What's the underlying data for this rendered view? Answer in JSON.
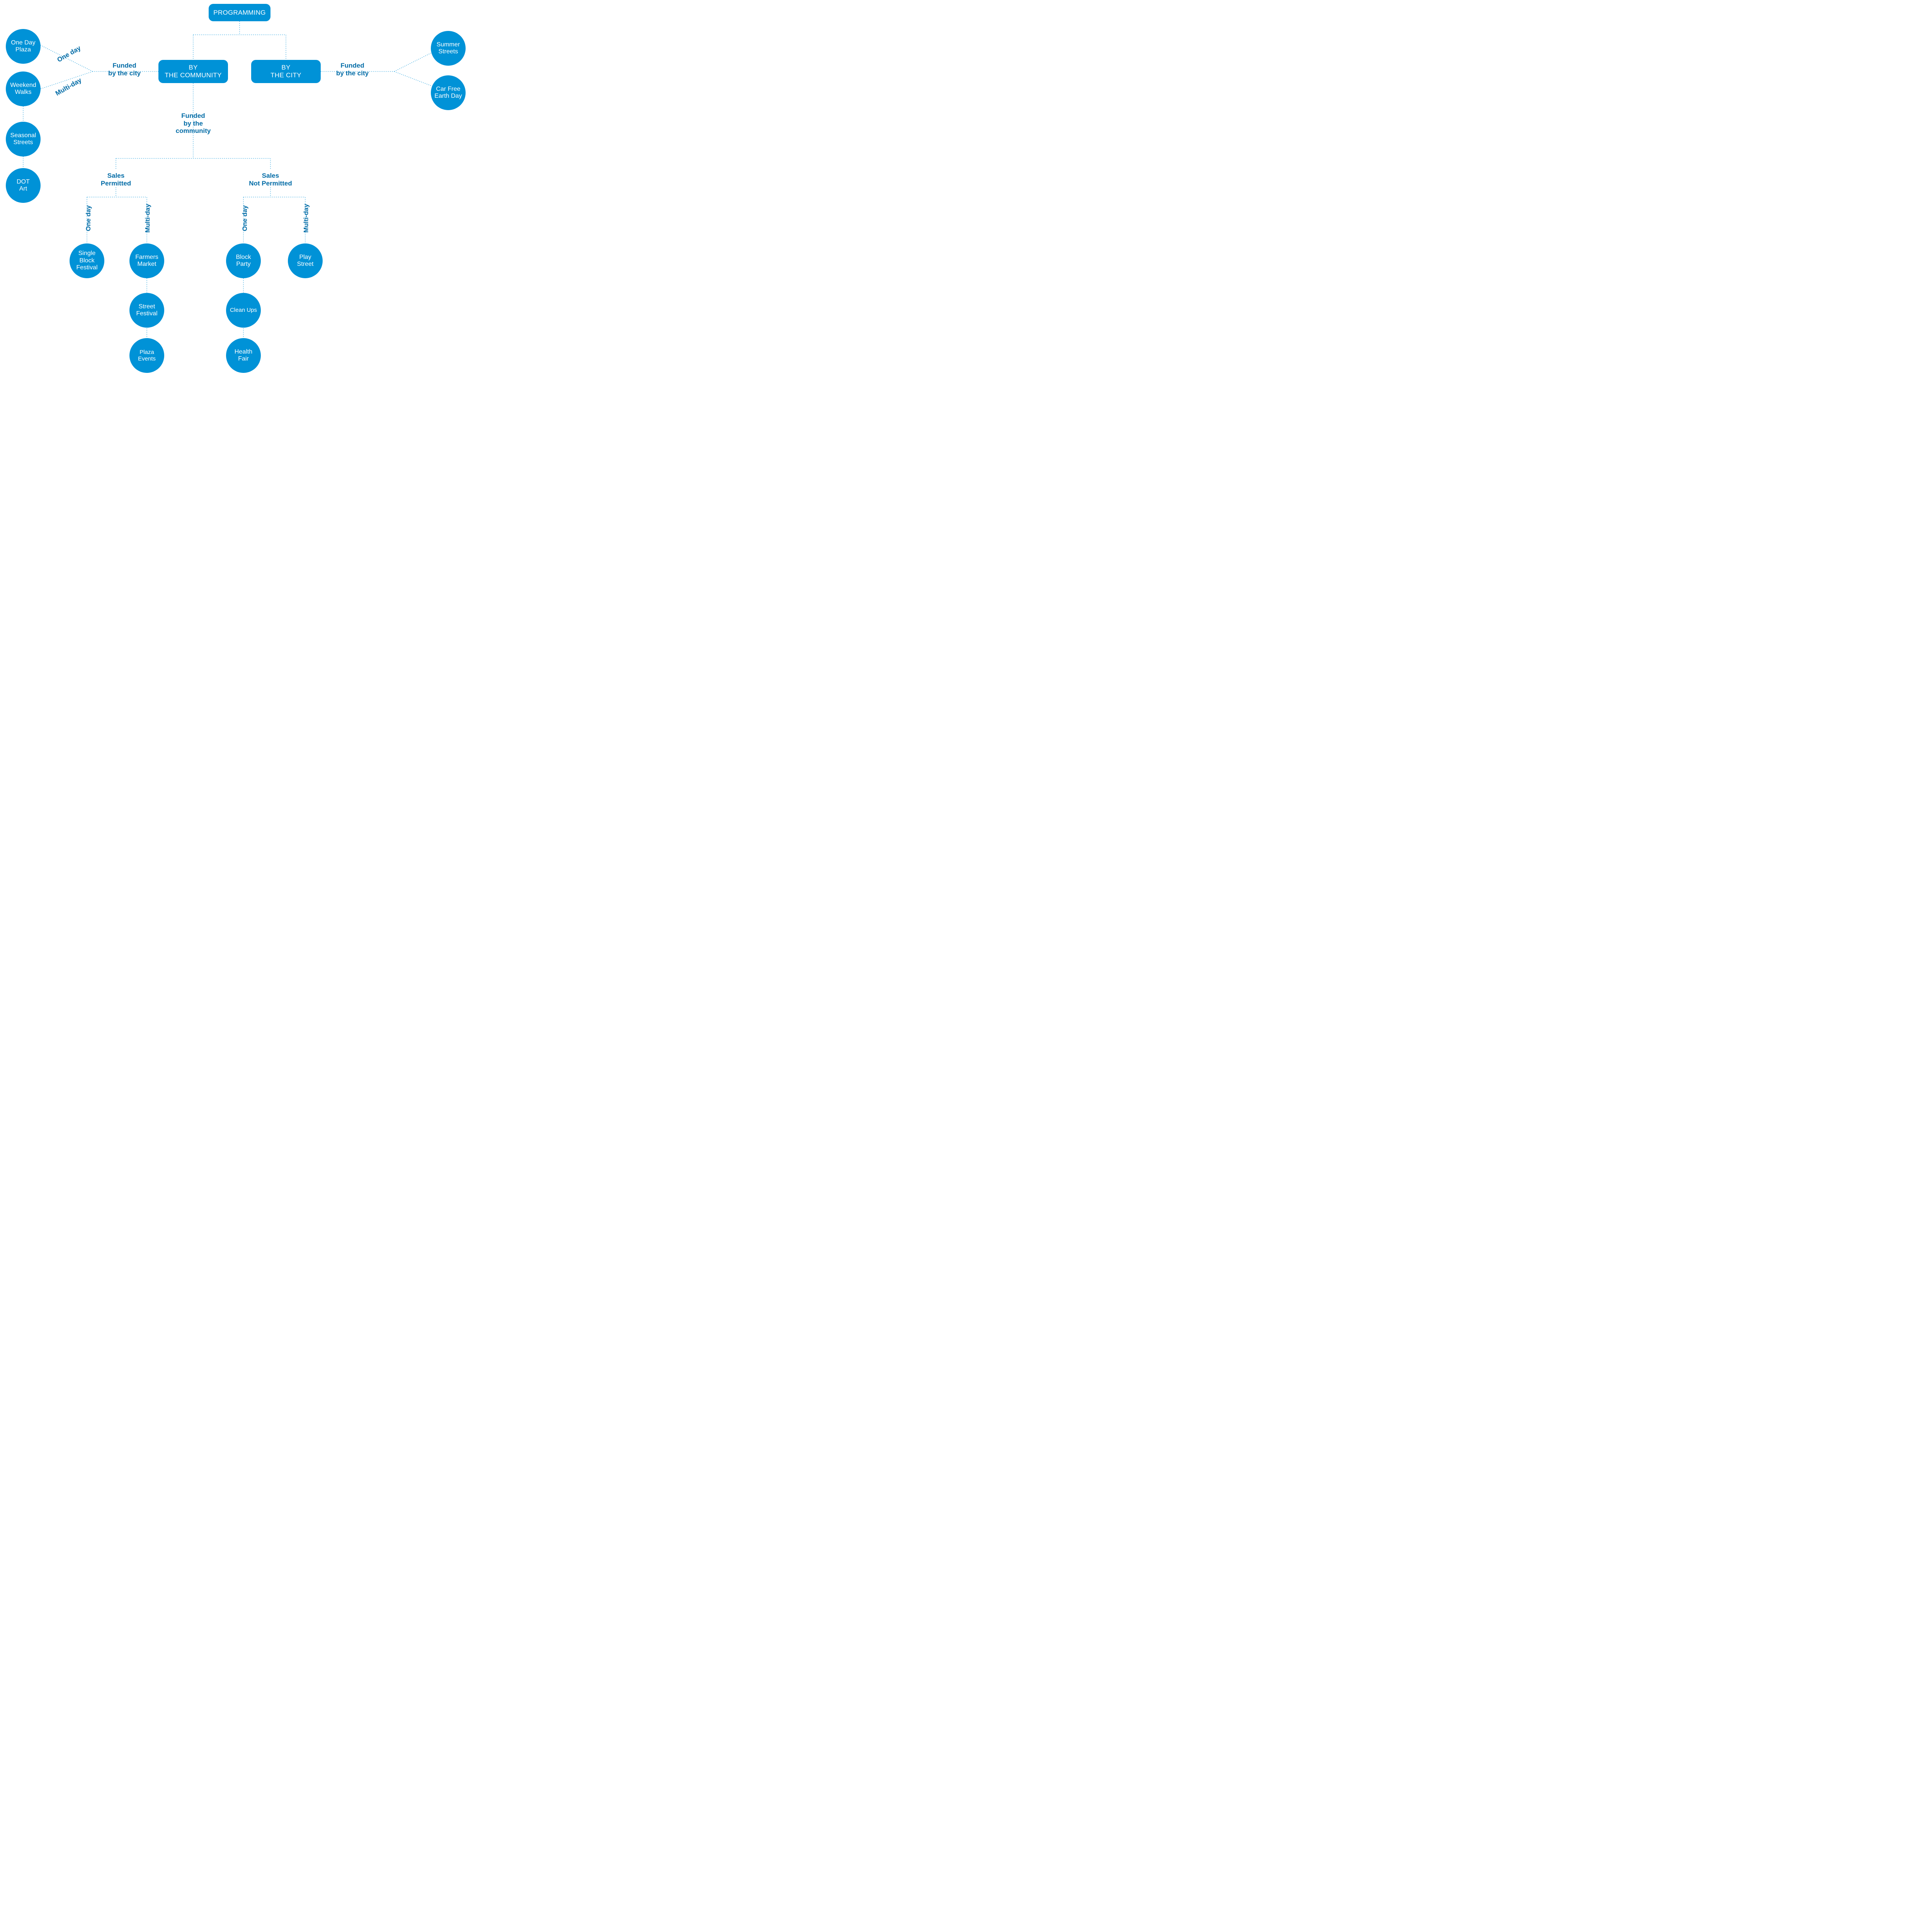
{
  "colors": {
    "primary": "#0092d7",
    "label": "#006ba6",
    "bg": "#ffffff"
  },
  "root": {
    "label": "PROGRAMMING"
  },
  "branches": {
    "community": {
      "label": "BY\nTHE COMMUNITY"
    },
    "city": {
      "label": "BY\nTHE CITY"
    }
  },
  "funding": {
    "community_left_funded_city": "Funded\nby the city",
    "community_down_funded_comm": "Funded\nby the community",
    "city_right_funded_city": "Funded\nby the city"
  },
  "duration_labels": {
    "one_day": "One day",
    "multi_day": "Multi-day"
  },
  "left_city_funded_examples": {
    "one_day": [
      "One Day\nPlaza"
    ],
    "multi_day": [
      "Weekend\nWalks",
      "Seasonal\nStreets",
      "DOT\nArt"
    ]
  },
  "right_city_funded_examples": [
    "Summer\nStreets",
    "Car Free\nEarth Day"
  ],
  "community_funded_split": {
    "sales_permitted": "Sales\nPermitted",
    "sales_not_permitted": "Sales\nNot Permitted"
  },
  "sales_permitted_examples": {
    "one_day": [
      "Single\nBlock\nFestival"
    ],
    "multi_day": [
      "Farmers\nMarket",
      "Street\nFestival",
      "Plaza\nEvents"
    ]
  },
  "sales_not_permitted_examples": {
    "one_day": [
      "Block\nParty",
      "Clean Ups",
      "Health\nFair"
    ],
    "multi_day": [
      "Play\nStreet"
    ]
  }
}
